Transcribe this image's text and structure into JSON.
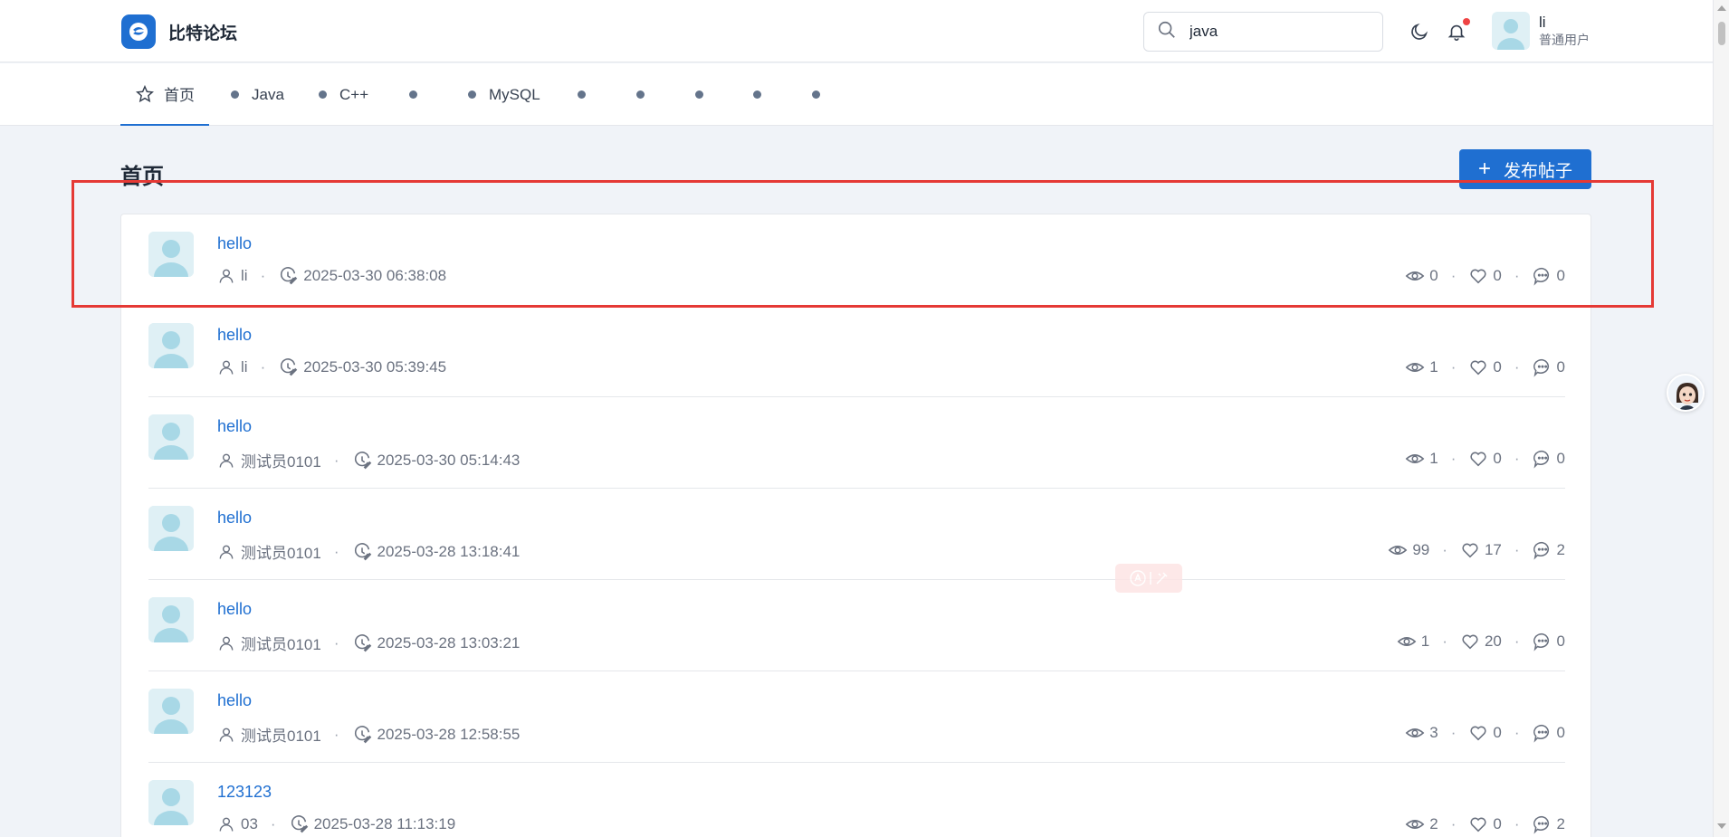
{
  "app": {
    "name": "比特论坛"
  },
  "search": {
    "value": "java"
  },
  "user": {
    "name": "li",
    "role": "普通用户"
  },
  "categories": [
    {
      "label": "首页",
      "icon": "star-icon",
      "active": true
    },
    {
      "label": "Java"
    },
    {
      "label": "C++"
    },
    {
      "label": ""
    },
    {
      "label": "MySQL"
    },
    {
      "label": ""
    },
    {
      "label": ""
    },
    {
      "label": ""
    },
    {
      "label": ""
    },
    {
      "label": ""
    }
  ],
  "page": {
    "title": "首页",
    "post_button": "发布帖子"
  },
  "posts": [
    {
      "title": "hello",
      "author": "li",
      "time": "2025-03-30 06:38:08",
      "views": "0",
      "likes": "0",
      "comments": "0"
    },
    {
      "title": "hello",
      "author": "li",
      "time": "2025-03-30 05:39:45",
      "views": "1",
      "likes": "0",
      "comments": "0"
    },
    {
      "title": "hello",
      "author": "测试员0101",
      "time": "2025-03-30 05:14:43",
      "views": "1",
      "likes": "0",
      "comments": "0"
    },
    {
      "title": "hello",
      "author": "测试员0101",
      "time": "2025-03-28 13:18:41",
      "views": "99",
      "likes": "17",
      "comments": "2"
    },
    {
      "title": "hello",
      "author": "测试员0101",
      "time": "2025-03-28 13:03:21",
      "views": "1",
      "likes": "20",
      "comments": "0"
    },
    {
      "title": "hello",
      "author": "测试员0101",
      "time": "2025-03-28 12:58:55",
      "views": "3",
      "likes": "0",
      "comments": "0"
    },
    {
      "title": "123123",
      "author": "03",
      "time": "2025-03-28 11:13:19",
      "views": "2",
      "likes": "0",
      "comments": "2"
    }
  ],
  "colors": {
    "accent": "#1f6fd1",
    "highlight": "#e53935",
    "notification": "#ef4444"
  }
}
